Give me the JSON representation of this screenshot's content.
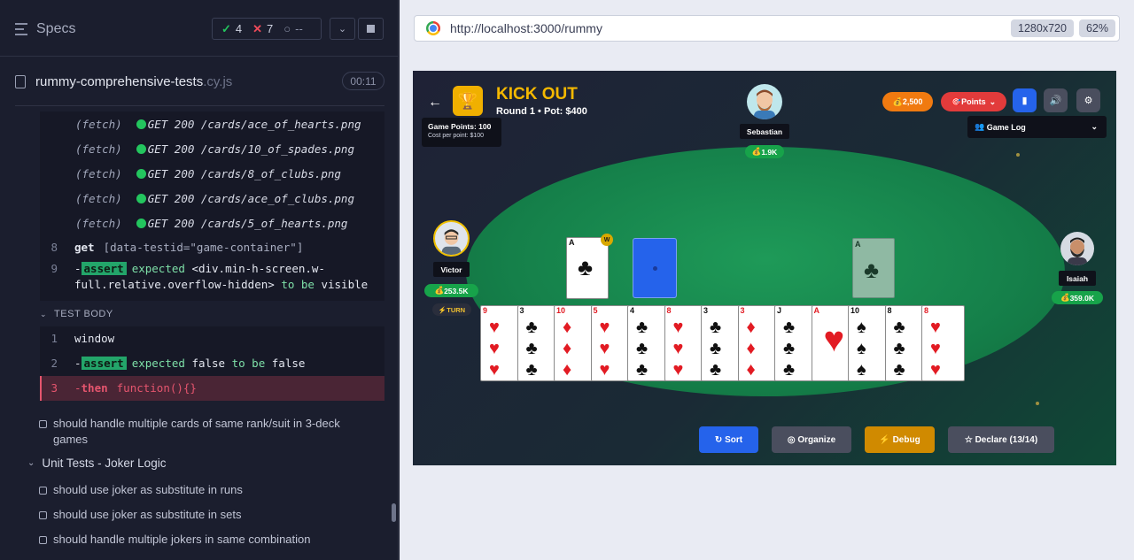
{
  "runner": {
    "title": "Specs",
    "stats": {
      "passed": "4",
      "failed": "7",
      "pending": "--"
    },
    "file": {
      "name": "rummy-comprehensive-tests",
      "ext": ".cy.js",
      "duration": "00:11"
    },
    "fetch_logs": [
      {
        "type": "(fetch)",
        "text": "GET 200 /cards/ace_of_hearts.png"
      },
      {
        "type": "(fetch)",
        "text": "GET 200 /cards/10_of_spades.png"
      },
      {
        "type": "(fetch)",
        "text": "GET 200 /cards/8_of_clubs.png"
      },
      {
        "type": "(fetch)",
        "text": "GET 200 /cards/ace_of_clubs.png"
      },
      {
        "type": "(fetch)",
        "text": "GET 200 /cards/5_of_hearts.png"
      }
    ],
    "cmd8": {
      "num": "8",
      "cmd": "get",
      "arg": "[data-testid=\"game-container\"]"
    },
    "cmd9": {
      "num": "9",
      "prefix": "-",
      "badge": "assert",
      "line1a": "expected",
      "line1b": "<div.min-h-screen.w-",
      "line2a": "full.relative.overflow-hidden>",
      "line2b": "to be",
      "line2c": "visible"
    },
    "test_body_label": "TEST BODY",
    "body": [
      {
        "num": "1",
        "text": "window"
      },
      {
        "num": "2",
        "prefix": "-",
        "badge": "assert",
        "a": "expected",
        "b": "false",
        "c": "to be",
        "d": "false"
      },
      {
        "num": "3",
        "prefix": "-",
        "cmd": "then",
        "arg": "function(){}"
      }
    ],
    "test_after": "should handle multiple cards of same rank/suit in 3-deck games",
    "group": "Unit Tests - Joker Logic",
    "group_tests": [
      "should use joker as substitute in runs",
      "should use joker as substitute in sets",
      "should handle multiple jokers in same combination"
    ]
  },
  "browser": {
    "url": "http://localhost:3000/rummy",
    "viewport": "1280x720",
    "zoom": "62%"
  },
  "game": {
    "title": "KICK OUT",
    "subtitle": "Round 1 • Pot: $400",
    "points_title": "Game Points: 100",
    "points_sub": "Cost per point: $100",
    "coins": "2,500",
    "points_btn": "Points",
    "game_log": "Game Log",
    "wild_badge": "W",
    "players": {
      "sebastian": {
        "name": "Sebastian",
        "chips": "1.9K"
      },
      "victor": {
        "name": "Victor",
        "chips": "253.5K",
        "turn": "TURN"
      },
      "isaiah": {
        "name": "Isaiah",
        "chips": "359.0K"
      }
    },
    "actions": {
      "sort": "Sort",
      "organize": "Organize",
      "debug": "Debug",
      "declare": "Declare (13/14)"
    },
    "colors": {
      "accent": "#f5b800",
      "sort": "#2563eb",
      "debug": "#d08a00",
      "felt": "#15804a"
    },
    "hand": [
      {
        "rank": "9",
        "suit": "♥",
        "color": "red"
      },
      {
        "rank": "3",
        "suit": "♣",
        "color": "blk"
      },
      {
        "rank": "10",
        "suit": "♦",
        "color": "red"
      },
      {
        "rank": "5",
        "suit": "♥",
        "color": "red"
      },
      {
        "rank": "4",
        "suit": "♣",
        "color": "blk"
      },
      {
        "rank": "8",
        "suit": "♥",
        "color": "red"
      },
      {
        "rank": "3",
        "suit": "♣",
        "color": "blk"
      },
      {
        "rank": "3",
        "suit": "♦",
        "color": "red"
      },
      {
        "rank": "J",
        "suit": "♣",
        "color": "blk"
      },
      {
        "rank": "A",
        "suit": "♥",
        "color": "red"
      },
      {
        "rank": "10",
        "suit": "♠",
        "color": "blk"
      },
      {
        "rank": "8",
        "suit": "♣",
        "color": "blk"
      },
      {
        "rank": "8",
        "suit": "♥",
        "color": "red"
      }
    ],
    "wild_card": {
      "rank": "A",
      "suit": "♣"
    },
    "discard_card": {
      "rank": "A",
      "suit": "♣"
    }
  }
}
